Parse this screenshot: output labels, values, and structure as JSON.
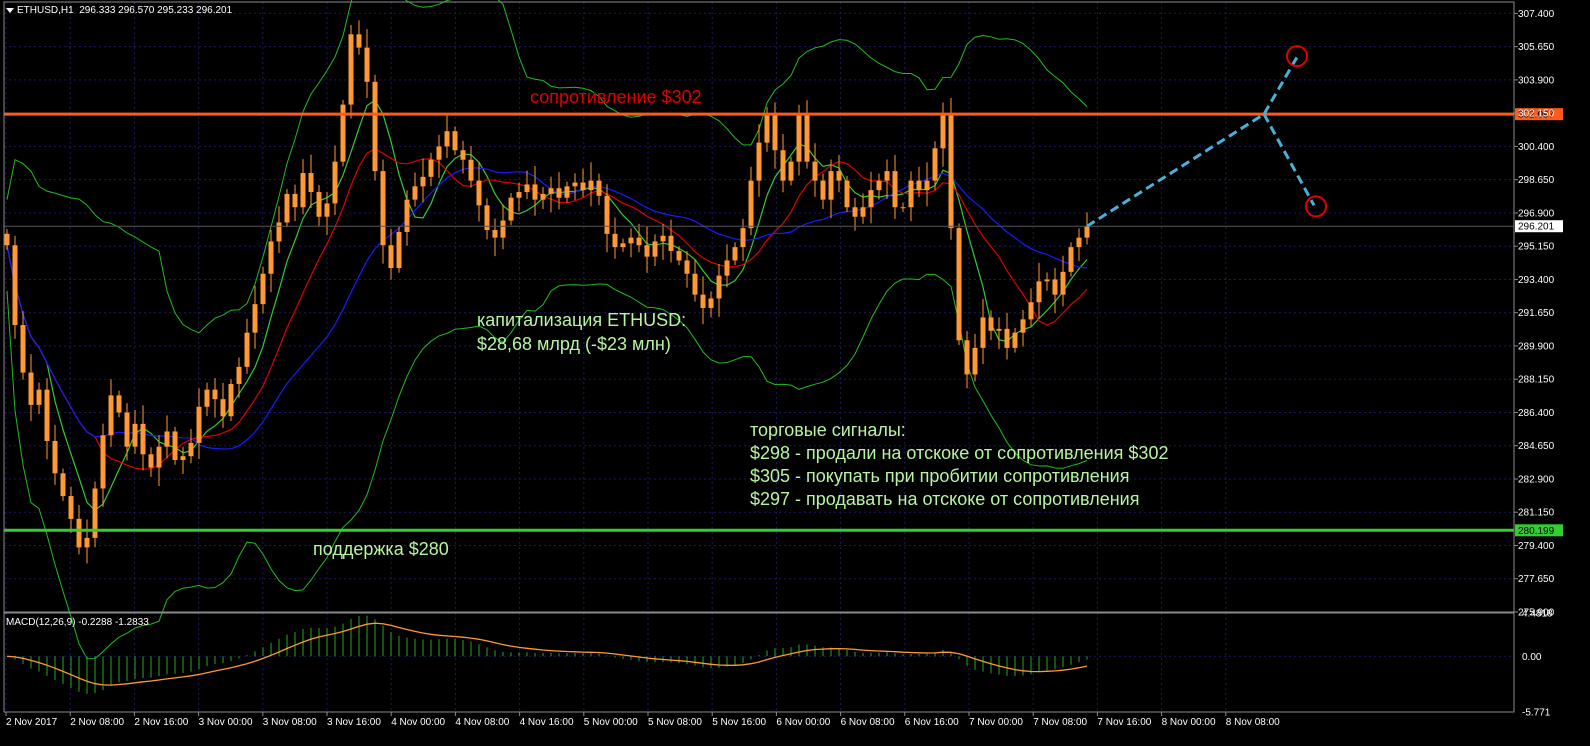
{
  "header": {
    "symbol": "ETHUSD,H1",
    "ohlc": "296.333 296.570 295.233 296.201"
  },
  "macd_label": "MACD(12,26,9) -0.2288 -1.2833",
  "annotations": {
    "resistance": "сопротивление $302",
    "support": "поддержка $280",
    "cap_line1": "капитализация ETHUSD:",
    "cap_line2": "$28,68 млрд (-$23 млн)",
    "signals_title": "торговые сигналы:",
    "signal_1": "$298 - продали на отскоке от сопротивления $302",
    "signal_2": "$305 - покупать при пробитии сопротивления",
    "signal_3": "$297 - продавать на отскоке от сопротивления"
  },
  "colors": {
    "bull": "#ff9933",
    "bear": "#ff9933",
    "resistance": "#ff5a1a",
    "support": "#33cc33",
    "ma_red": "#e00000",
    "ma_blue": "#1a1aff",
    "ma_green": "#33cc33",
    "bands": "#22bb22",
    "grid": "#1a1a66",
    "forecast": "#4ab0d9",
    "macd_hist": "#22aa22",
    "macd_signal": "#ff9933"
  },
  "chart_data": {
    "type": "candlestick",
    "y_axis": {
      "range": [
        275.9,
        308.0
      ],
      "ticks": [
        "307.400",
        "305.650",
        "303.900",
        "302.150",
        "300.400",
        "298.650",
        "296.900",
        "295.150",
        "293.400",
        "291.650",
        "289.900",
        "288.150",
        "286.400",
        "284.650",
        "282.900",
        "281.150",
        "279.400",
        "277.650",
        "275.900"
      ]
    },
    "levels": {
      "resistance": 302.097,
      "support": 280.199,
      "current": 296.201,
      "resistance_label": "302.097",
      "support_label": "280.199",
      "current_label": "296.201"
    },
    "x_axis": {
      "labels": [
        "2 Nov 2017",
        "2 Nov 08:00",
        "2 Nov 16:00",
        "3 Nov 00:00",
        "3 Nov 08:00",
        "3 Nov 16:00",
        "4 Nov 00:00",
        "4 Nov 08:00",
        "4 Nov 16:00",
        "5 Nov 00:00",
        "5 Nov 08:00",
        "5 Nov 16:00",
        "6 Nov 00:00",
        "6 Nov 08:00",
        "6 Nov 16:00",
        "7 Nov 00:00",
        "7 Nov 08:00",
        "7 Nov 16:00",
        "8 Nov 00:00",
        "8 Nov 08:00"
      ]
    },
    "candles_close": [
      295.2,
      291.0,
      288.5,
      286.8,
      287.6,
      284.9,
      283.2,
      282.0,
      280.8,
      279.3,
      279.8,
      282.4,
      285.2,
      287.3,
      286.4,
      284.6,
      285.8,
      284.2,
      283.5,
      284.6,
      285.4,
      283.9,
      284.1,
      284.8,
      286.7,
      287.6,
      287.1,
      286.2,
      287.9,
      288.8,
      290.6,
      292.1,
      293.7,
      295.4,
      296.4,
      297.9,
      297.2,
      299.0,
      298.0,
      296.7,
      297.4,
      299.6,
      302.6,
      306.3,
      305.6,
      303.8,
      299.1,
      295.2,
      294.0,
      295.9,
      297.6,
      298.3,
      298.8,
      299.7,
      300.4,
      301.2,
      300.2,
      299.7,
      298.6,
      297.3,
      296.0,
      295.6,
      296.5,
      297.7,
      298.0,
      298.4,
      297.6,
      297.9,
      298.2,
      297.7,
      298.3,
      298.5,
      298.1,
      298.6,
      297.8,
      295.8,
      295.1,
      295.3,
      295.6,
      295.2,
      294.6,
      295.4,
      295.7,
      294.9,
      294.4,
      293.7,
      292.6,
      291.9,
      292.4,
      293.6,
      294.4,
      295.1,
      296.1,
      298.6,
      300.6,
      302.1,
      300.2,
      298.6,
      299.6,
      302.1,
      299.6,
      298.6,
      297.6,
      299.1,
      298.6,
      297.2,
      296.7,
      297.2,
      298.1,
      298.6,
      299.1,
      297.2,
      297.2,
      298.6,
      298.1,
      298.6,
      300.3,
      302.1,
      296.1,
      290.2,
      288.4,
      289.8,
      291.4,
      290.7,
      290.8,
      289.8,
      290.6,
      291.3,
      292.2,
      293.3,
      293.4,
      292.6,
      293.8,
      295.1,
      295.6,
      296.2
    ],
    "macd_axis": {
      "range": [
        -5.771,
        4.4818
      ],
      "ticks": [
        "4.4818",
        "0.00",
        "-5.771"
      ]
    }
  }
}
